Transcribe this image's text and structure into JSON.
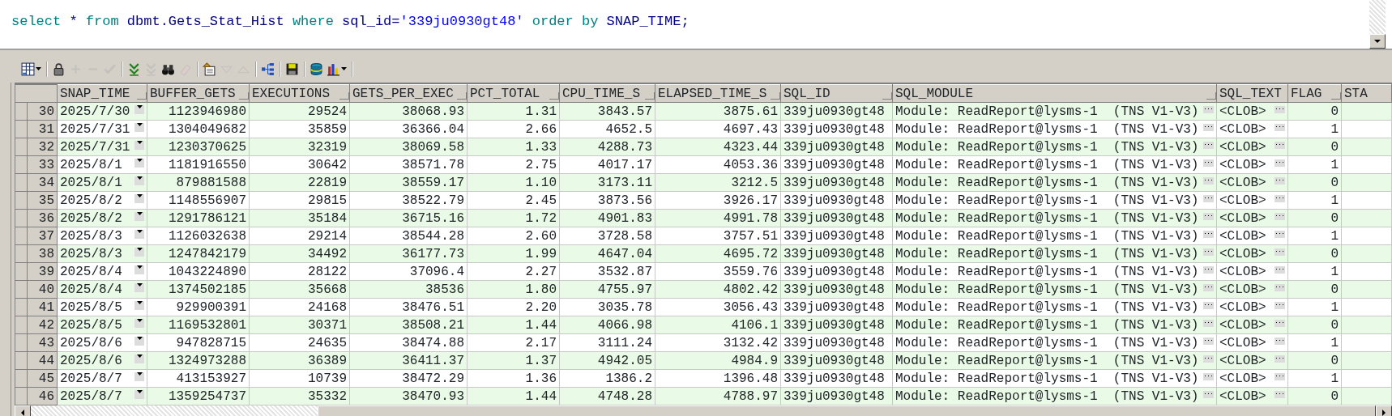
{
  "editor": {
    "tokens": [
      {
        "text": "select",
        "kind": "keyword"
      },
      {
        "text": "*",
        "kind": "identifier"
      },
      {
        "text": "from",
        "kind": "keyword"
      },
      {
        "text": "dbmt.Gets_Stat_Hist",
        "kind": "identifier"
      },
      {
        "text": "where",
        "kind": "keyword"
      },
      {
        "text": "sql_id=",
        "kind": "identifier"
      },
      {
        "text": "'339ju0930gt48'",
        "kind": "string"
      },
      {
        "text": "order by",
        "kind": "keyword"
      },
      {
        "text": "SNAP_TIME;",
        "kind": "identifier"
      }
    ]
  },
  "toolbar": {
    "groups": [
      [
        {
          "kind": "grid",
          "disabled": false,
          "dropdown": true
        }
      ],
      [
        {
          "kind": "lock",
          "disabled": false,
          "dropdown": false
        },
        {
          "kind": "plus",
          "disabled": true,
          "dropdown": false
        },
        {
          "kind": "minus",
          "disabled": true,
          "dropdown": false
        },
        {
          "kind": "check",
          "disabled": true,
          "dropdown": false
        }
      ],
      [
        {
          "kind": "chevrons",
          "disabled": false,
          "dropdown": false
        },
        {
          "kind": "chevrons",
          "disabled": true,
          "dropdown": false
        },
        {
          "kind": "binoculars",
          "disabled": false,
          "dropdown": false
        },
        {
          "kind": "eraser",
          "disabled": true,
          "dropdown": false
        }
      ],
      [
        {
          "kind": "import",
          "disabled": false,
          "dropdown": false
        },
        {
          "kind": "down",
          "disabled": true,
          "dropdown": false
        },
        {
          "kind": "up",
          "disabled": true,
          "dropdown": false
        }
      ],
      [
        {
          "kind": "tree",
          "disabled": false,
          "dropdown": false
        }
      ],
      [
        {
          "kind": "save",
          "disabled": false,
          "dropdown": false
        }
      ],
      [
        {
          "kind": "database",
          "disabled": false,
          "dropdown": false
        },
        {
          "kind": "chart",
          "disabled": false,
          "dropdown": true
        }
      ]
    ]
  },
  "table": {
    "columns": [
      {
        "label": "SNAP_TIME",
        "kind": "dropdown",
        "marker": true
      },
      {
        "label": "BUFFER_GETS",
        "kind": "number",
        "marker": true
      },
      {
        "label": "EXECUTIONS",
        "kind": "number",
        "marker": true
      },
      {
        "label": "GETS_PER_EXEC",
        "kind": "number",
        "marker": true
      },
      {
        "label": "PCT_TOTAL",
        "kind": "number",
        "marker": true
      },
      {
        "label": "CPU_TIME_S",
        "kind": "number",
        "marker": true
      },
      {
        "label": "ELAPSED_TIME_S",
        "kind": "number",
        "marker": true
      },
      {
        "label": "SQL_ID",
        "kind": "text",
        "marker": true
      },
      {
        "label": "SQL_MODULE",
        "kind": "ellipsis",
        "marker": true
      },
      {
        "label": "SQL_TEXT",
        "kind": "ellipsis",
        "marker": false
      },
      {
        "label": "FLAG",
        "kind": "number",
        "marker": true
      },
      {
        "label": "STA",
        "kind": "text",
        "marker": false
      }
    ],
    "rows": [
      {
        "row_number": "30",
        "cells": [
          "2025/7/30",
          "1123946980",
          "29524",
          "38068.93",
          "1.31",
          "3843.57",
          "3875.61",
          "339ju0930gt48",
          "Module: ReadReport@lysms-1  (TNS V1-V3)",
          "<CLOB>",
          "0"
        ]
      },
      {
        "row_number": "31",
        "cells": [
          "2025/7/31",
          "1304049682",
          "35859",
          "36366.04",
          "2.66",
          "4652.5",
          "4697.43",
          "339ju0930gt48",
          "Module: ReadReport@lysms-1  (TNS V1-V3)",
          "<CLOB>",
          "1"
        ]
      },
      {
        "row_number": "32",
        "cells": [
          "2025/7/31",
          "1230370625",
          "32319",
          "38069.58",
          "1.33",
          "4288.73",
          "4323.44",
          "339ju0930gt48",
          "Module: ReadReport@lysms-1  (TNS V1-V3)",
          "<CLOB>",
          "0"
        ]
      },
      {
        "row_number": "33",
        "cells": [
          "2025/8/1",
          "1181916550",
          "30642",
          "38571.78",
          "2.75",
          "4017.17",
          "4053.36",
          "339ju0930gt48",
          "Module: ReadReport@lysms-1  (TNS V1-V3)",
          "<CLOB>",
          "1"
        ]
      },
      {
        "row_number": "34",
        "cells": [
          "2025/8/1",
          "879881588",
          "22819",
          "38559.17",
          "1.10",
          "3173.11",
          "3212.5",
          "339ju0930gt48",
          "Module: ReadReport@lysms-1  (TNS V1-V3)",
          "<CLOB>",
          "0"
        ]
      },
      {
        "row_number": "35",
        "cells": [
          "2025/8/2",
          "1148556907",
          "29815",
          "38522.79",
          "2.45",
          "3873.56",
          "3926.17",
          "339ju0930gt48",
          "Module: ReadReport@lysms-1  (TNS V1-V3)",
          "<CLOB>",
          "1"
        ]
      },
      {
        "row_number": "36",
        "cells": [
          "2025/8/2",
          "1291786121",
          "35184",
          "36715.16",
          "1.72",
          "4901.83",
          "4991.78",
          "339ju0930gt48",
          "Module: ReadReport@lysms-1  (TNS V1-V3)",
          "<CLOB>",
          "0"
        ]
      },
      {
        "row_number": "37",
        "cells": [
          "2025/8/3",
          "1126032638",
          "29214",
          "38544.28",
          "2.60",
          "3728.58",
          "3757.51",
          "339ju0930gt48",
          "Module: ReadReport@lysms-1  (TNS V1-V3)",
          "<CLOB>",
          "1"
        ]
      },
      {
        "row_number": "38",
        "cells": [
          "2025/8/3",
          "1247842179",
          "34492",
          "36177.73",
          "1.99",
          "4647.04",
          "4695.72",
          "339ju0930gt48",
          "Module: ReadReport@lysms-1  (TNS V1-V3)",
          "<CLOB>",
          "0"
        ]
      },
      {
        "row_number": "39",
        "cells": [
          "2025/8/4",
          "1043224890",
          "28122",
          "37096.4",
          "2.27",
          "3532.87",
          "3559.76",
          "339ju0930gt48",
          "Module: ReadReport@lysms-1  (TNS V1-V3)",
          "<CLOB>",
          "1"
        ]
      },
      {
        "row_number": "40",
        "cells": [
          "2025/8/4",
          "1374502185",
          "35668",
          "38536",
          "1.80",
          "4755.97",
          "4802.42",
          "339ju0930gt48",
          "Module: ReadReport@lysms-1  (TNS V1-V3)",
          "<CLOB>",
          "0"
        ]
      },
      {
        "row_number": "41",
        "cells": [
          "2025/8/5",
          "929900391",
          "24168",
          "38476.51",
          "2.20",
          "3035.78",
          "3056.43",
          "339ju0930gt48",
          "Module: ReadReport@lysms-1  (TNS V1-V3)",
          "<CLOB>",
          "1"
        ]
      },
      {
        "row_number": "42",
        "cells": [
          "2025/8/5",
          "1169532801",
          "30371",
          "38508.21",
          "1.44",
          "4066.98",
          "4106.1",
          "339ju0930gt48",
          "Module: ReadReport@lysms-1  (TNS V1-V3)",
          "<CLOB>",
          "0"
        ]
      },
      {
        "row_number": "43",
        "cells": [
          "2025/8/6",
          "947828715",
          "24635",
          "38474.88",
          "2.17",
          "3111.24",
          "3132.42",
          "339ju0930gt48",
          "Module: ReadReport@lysms-1  (TNS V1-V3)",
          "<CLOB>",
          "1"
        ]
      },
      {
        "row_number": "44",
        "cells": [
          "2025/8/6",
          "1324973288",
          "36389",
          "36411.37",
          "1.37",
          "4942.05",
          "4984.9",
          "339ju0930gt48",
          "Module: ReadReport@lysms-1  (TNS V1-V3)",
          "<CLOB>",
          "0"
        ]
      },
      {
        "row_number": "45",
        "cells": [
          "2025/8/7",
          "413153927",
          "10739",
          "38472.29",
          "1.36",
          "1386.2",
          "1396.48",
          "339ju0930gt48",
          "Module: ReadReport@lysms-1  (TNS V1-V3)",
          "<CLOB>",
          "1"
        ]
      },
      {
        "row_number": "46",
        "cells": [
          "2025/8/7",
          "1359254737",
          "35332",
          "38470.93",
          "1.44",
          "4748.28",
          "4788.97",
          "339ju0930gt48",
          "Module: ReadReport@lysms-1  (TNS V1-V3)",
          "<CLOB>",
          "0"
        ]
      }
    ]
  }
}
